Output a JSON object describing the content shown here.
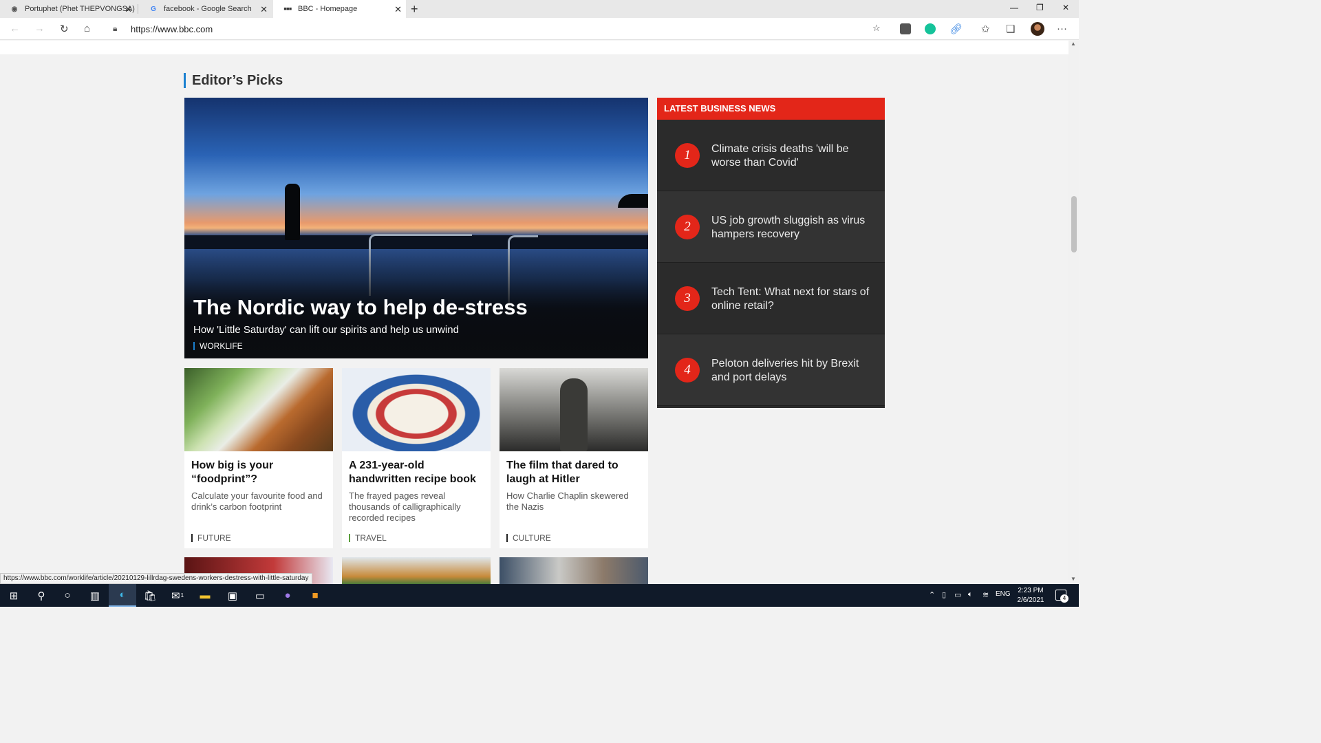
{
  "browser": {
    "tabs": [
      {
        "title": "Portuphet (Phet THEPVONGSA)",
        "icon": "github-icon",
        "close": "✕"
      },
      {
        "title": "facebook - Google Search",
        "icon": "google-icon",
        "close": "✕"
      },
      {
        "title": "BBC - Homepage",
        "icon": "bbc-icon",
        "close": "✕"
      }
    ],
    "new_tab": "+",
    "window_controls": {
      "minimize": "—",
      "restore": "❐",
      "close": "✕"
    },
    "url": "https://www.bbc.com",
    "menu": "···"
  },
  "page": {
    "section_title": "Editor’s Picks",
    "hero": {
      "title": "The Nordic way to help de-stress",
      "subtitle": "How 'Little Saturday' can lift our spirits and help us unwind",
      "tag": "WORKLIFE"
    },
    "cards": [
      {
        "title": "How big is your “foodprint”?",
        "subtitle": "Calculate your favourite food and drink’s carbon footprint",
        "tag": "FUTURE"
      },
      {
        "title": "A 231-year-old handwritten recipe book",
        "subtitle": "The frayed pages reveal thousands of calligraphically recorded recipes",
        "tag": "TRAVEL"
      },
      {
        "title": "The film that dared to laugh at Hitler",
        "subtitle": "How Charlie Chaplin skewered the Nazis",
        "tag": "CULTURE"
      }
    ],
    "latest_business": {
      "heading": "LATEST BUSINESS NEWS",
      "items": [
        {
          "num": "1",
          "text": "Climate crisis deaths 'will be worse than Covid'"
        },
        {
          "num": "2",
          "text": "US job growth sluggish as virus hampers recovery"
        },
        {
          "num": "3",
          "text": "Tech Tent: What next for stars of online retail?"
        },
        {
          "num": "4",
          "text": "Peloton deliveries hit by Brexit and port delays"
        }
      ]
    },
    "status_url": "https://www.bbc.com/worklife/article/20210129-lillrdag-swedens-workers-destress-with-little-saturday"
  },
  "taskbar": {
    "language": "ENG",
    "time": "2:23 PM",
    "date": "2/6/2021",
    "notification_count": "4",
    "mail_badge": "1"
  },
  "colors": {
    "bbc_red": "#e32619",
    "worklife_accent": "#1a80d0",
    "travel_accent": "#5a9e3b",
    "dark_panel": "#2b2b2b"
  }
}
